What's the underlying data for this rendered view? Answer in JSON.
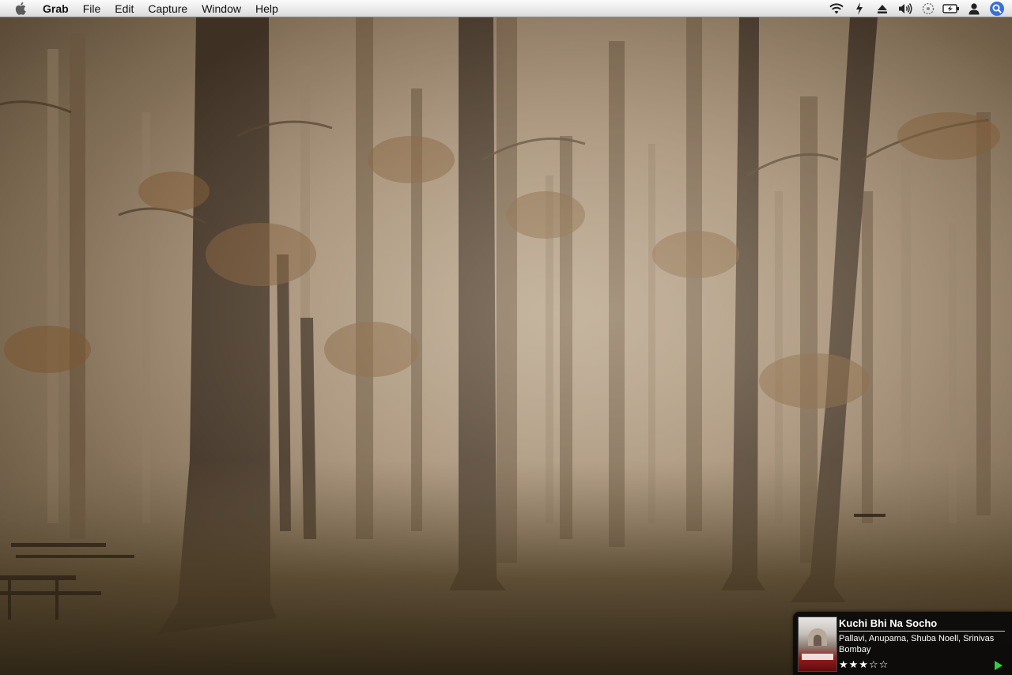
{
  "menubar": {
    "app_name": "Grab",
    "items": [
      {
        "label": "File"
      },
      {
        "label": "Edit"
      },
      {
        "label": "Capture"
      },
      {
        "label": "Window"
      },
      {
        "label": "Help"
      }
    ],
    "status_icons": [
      "wifi-icon",
      "charger-icon",
      "eject-icon",
      "volume-icon",
      "sync-icon",
      "battery-icon",
      "user-icon",
      "spotlight-icon"
    ]
  },
  "now_playing": {
    "title": "Kuchi Bhi Na Socho",
    "artist": "Pallavi, Anupama, Shuba Noell, Srinivas",
    "album": "Bombay",
    "rating_text": "★★★☆☆",
    "rating": 3,
    "rating_max": 5,
    "play_color": "#2fd13b"
  },
  "colors": {
    "fog_light": "#bfae98",
    "fog_dark": "#4a3c2a",
    "trunk": "#3e3023"
  }
}
